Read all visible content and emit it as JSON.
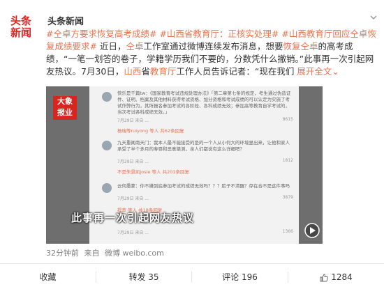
{
  "post": {
    "author": "头条新闻",
    "avatar_text_line1": "头条",
    "avatar_text_line2": "新闻",
    "content": {
      "tag1": "#仝卓方要求恢复高考成绩#",
      "tag2": "#山西省教育厅：正核实处理#",
      "tag3": "#山西教育厅回应仝卓恢复成绩要求#",
      "t1": " 近日，",
      "name1": "仝卓",
      "t2": "工作室通过微博连续发布消息，想要",
      "hl1": "恢复仝卓",
      "t3": "的高考成绩，",
      "hl2": "“一笔一划答的卷子，学籍学历我们不要的，分数凭什么撤销。”",
      "t4": "此事再一次引起网友热议。7月30日，",
      "hl3": "山西",
      "t5": "省",
      "hl4": "教育厅",
      "t6": "工作人员告诉记者：“现在我们 ",
      "more": "展开全文",
      "more_arrow": "⌄"
    },
    "media": {
      "logo_line1": "大象",
      "logo_line2": "报业",
      "caption": "此事再一次引起网友热议",
      "comments": [
        {
          "text": "快乐是千篇tw：《国家教育考试违规处理办法》「第二章第七条的规定，考生通过伪造证件、证明、档案及其他材料获得考试资格、加分资格和考试成绩的可以认定为实施了考试作弊行为，其所报名参加考试的各阶段、各科成绩无效；参加高等教育自学考试的，当次考试各科成绩无效。」",
          "meta_left": "7月29日 来自 ...",
          "meta_right": "8615"
        },
        {
          "text": "杨瑞等ruiyong 等人 共62条回复",
          "meta_left": "",
          "meta_right": ""
        },
        {
          "text": "九天重阁南天门：我本人最不能接受的是的一个人从小何大的环境里出来，让他和家人承受了半个多月的寿辱和恶意猜测，亲人们都说有这么详细吧？",
          "meta_left": "7月29日 来自 ...",
          "meta_right": "1812"
        },
        {
          "text": "不是朱景凯josie 等人 共201条回复",
          "meta_left": "",
          "meta_right": ""
        },
        {
          "text": "云何愚蒙：你不嫌到底参加考试的成绩无效吗？？？脸子不清醒？存在合不是这件事吗",
          "meta_left": "7月29日 来自 ...",
          "meta_right": "3879"
        },
        {
          "text": "提萃 等人 共18条回复",
          "meta_left": "",
          "meta_right": ""
        },
        {
          "text": "7月29日 来自 ...",
          "meta_left": "",
          "meta_right": "1366"
        }
      ]
    },
    "meta": {
      "time": "32分钟前",
      "source_prefix": "来自",
      "source": "微博 weibo.com"
    },
    "actions": {
      "favorite": "收藏",
      "repost": "转发 35",
      "comment": "评论 196",
      "like": "1284"
    }
  }
}
